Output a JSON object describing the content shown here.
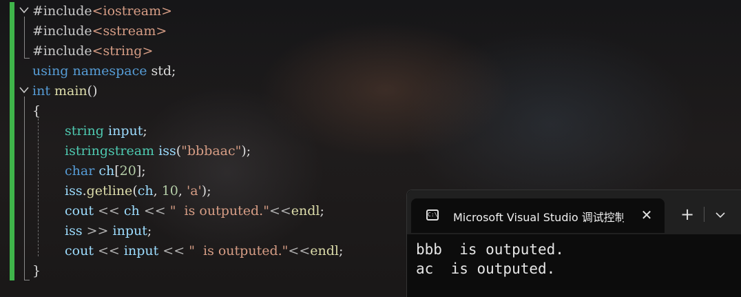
{
  "editor": {
    "lines": [
      [
        {
          "t": "#include",
          "c": "pp"
        },
        {
          "t": "<iostream>",
          "c": "hdr"
        }
      ],
      [
        {
          "t": "#include",
          "c": "pp"
        },
        {
          "t": "<sstream>",
          "c": "hdr"
        }
      ],
      [
        {
          "t": "#include",
          "c": "pp"
        },
        {
          "t": "<string>",
          "c": "hdr"
        }
      ],
      [
        {
          "t": "using",
          "c": "kw"
        },
        {
          "t": " ",
          "c": ""
        },
        {
          "t": "namespace",
          "c": "kw"
        },
        {
          "t": " std;",
          "c": ""
        }
      ],
      [
        {
          "t": "int",
          "c": "kw"
        },
        {
          "t": " ",
          "c": ""
        },
        {
          "t": "main",
          "c": "fn"
        },
        {
          "t": "()",
          "c": ""
        }
      ],
      [
        {
          "t": "{",
          "c": ""
        }
      ],
      [
        {
          "t": "string",
          "c": "type"
        },
        {
          "t": " ",
          "c": ""
        },
        {
          "t": "input",
          "c": "var"
        },
        {
          "t": ";",
          "c": ""
        }
      ],
      [
        {
          "t": "istringstream",
          "c": "type"
        },
        {
          "t": " ",
          "c": ""
        },
        {
          "t": "iss",
          "c": "var"
        },
        {
          "t": "(",
          "c": ""
        },
        {
          "t": "\"bbbaac\"",
          "c": "str"
        },
        {
          "t": ");",
          "c": ""
        }
      ],
      [
        {
          "t": "char",
          "c": "kw"
        },
        {
          "t": " ",
          "c": ""
        },
        {
          "t": "ch",
          "c": "var"
        },
        {
          "t": "[",
          "c": ""
        },
        {
          "t": "20",
          "c": "num"
        },
        {
          "t": "];",
          "c": ""
        }
      ],
      [
        {
          "t": "iss",
          "c": "var"
        },
        {
          "t": ".",
          "c": ""
        },
        {
          "t": "getline",
          "c": "fn"
        },
        {
          "t": "(",
          "c": ""
        },
        {
          "t": "ch",
          "c": "var"
        },
        {
          "t": ", ",
          "c": ""
        },
        {
          "t": "10",
          "c": "num"
        },
        {
          "t": ", ",
          "c": ""
        },
        {
          "t": "'a'",
          "c": "str"
        },
        {
          "t": ");",
          "c": ""
        }
      ],
      [
        {
          "t": "cout",
          "c": "var"
        },
        {
          "t": " ",
          "c": ""
        },
        {
          "t": "<<",
          "c": "op"
        },
        {
          "t": " ",
          "c": ""
        },
        {
          "t": "ch",
          "c": "var"
        },
        {
          "t": " ",
          "c": ""
        },
        {
          "t": "<<",
          "c": "op"
        },
        {
          "t": " ",
          "c": ""
        },
        {
          "t": "\"  is outputed.\"",
          "c": "str"
        },
        {
          "t": "<<",
          "c": "op"
        },
        {
          "t": "endl",
          "c": "fn"
        },
        {
          "t": ";",
          "c": ""
        }
      ],
      [
        {
          "t": "iss",
          "c": "var"
        },
        {
          "t": " ",
          "c": ""
        },
        {
          "t": ">>",
          "c": "op"
        },
        {
          "t": " ",
          "c": ""
        },
        {
          "t": "input",
          "c": "var"
        },
        {
          "t": ";",
          "c": ""
        }
      ],
      [
        {
          "t": "cout",
          "c": "var"
        },
        {
          "t": " ",
          "c": ""
        },
        {
          "t": "<<",
          "c": "op"
        },
        {
          "t": " ",
          "c": ""
        },
        {
          "t": "input",
          "c": "var"
        },
        {
          "t": " ",
          "c": ""
        },
        {
          "t": "<<",
          "c": "op"
        },
        {
          "t": " ",
          "c": ""
        },
        {
          "t": "\"  is outputed.\"",
          "c": "str"
        },
        {
          "t": "<<",
          "c": "op"
        },
        {
          "t": "endl",
          "c": "fn"
        },
        {
          "t": ";",
          "c": ""
        }
      ],
      [
        {
          "t": "}",
          "c": ""
        }
      ]
    ],
    "indented_lines": [
      6,
      7,
      8,
      9,
      10,
      11,
      12
    ]
  },
  "console": {
    "tab_icon_text": "C:\\",
    "tab_title": "Microsoft Visual Studio 调试控制台",
    "close_glyph": "✕",
    "new_tab_glyph": "+",
    "output": [
      "bbb  is outputed.",
      "ac  is outputed."
    ]
  },
  "colors": {
    "change_bar": "#3fb54a",
    "keyword": "#569cd6",
    "type": "#4ec9b0",
    "string": "#d69d85",
    "console_bg": "#0c0c0c"
  }
}
